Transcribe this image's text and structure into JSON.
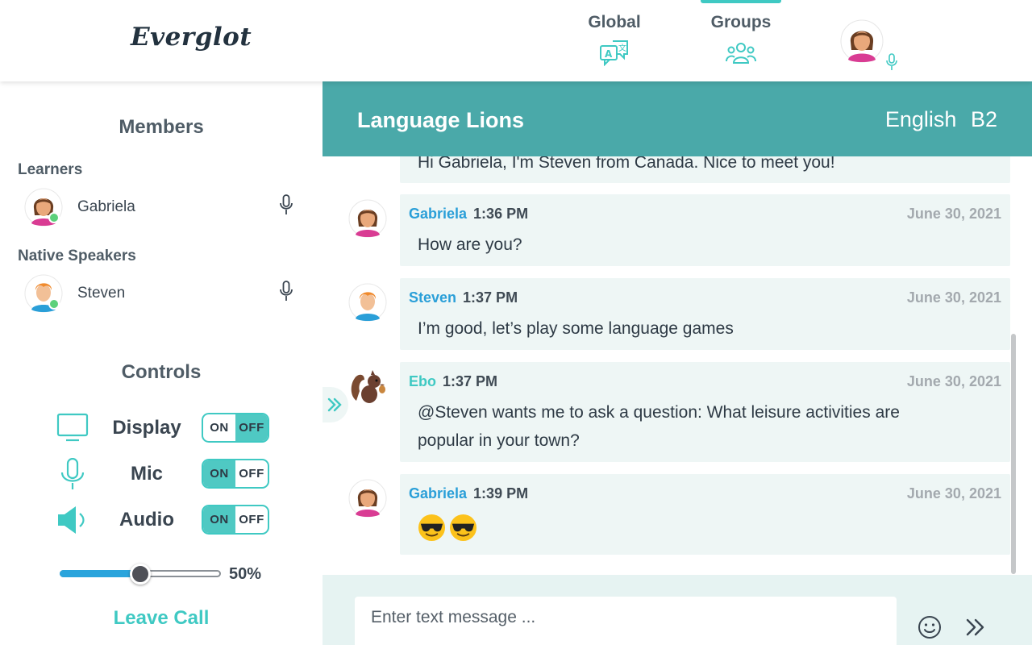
{
  "app": {
    "logo": "Everglot"
  },
  "nav": {
    "tabs": [
      {
        "label": "Global",
        "icon": "translate-icon",
        "active": false
      },
      {
        "label": "Groups",
        "icon": "group-icon",
        "active": true
      }
    ],
    "user_avatar": "user-avatar",
    "user_mic_icon": "mic-icon"
  },
  "sidebar": {
    "members_title": "Members",
    "learners_label": "Learners",
    "learners": [
      {
        "name": "Gabriela",
        "online": true
      }
    ],
    "native_label": "Native Speakers",
    "natives": [
      {
        "name": "Steven",
        "online": true
      }
    ],
    "controls_title": "Controls",
    "controls": [
      {
        "label": "Display",
        "icon": "monitor-icon",
        "on": "ON",
        "off": "OFF",
        "state": "OFF"
      },
      {
        "label": "Mic",
        "icon": "microphone-icon",
        "on": "ON",
        "off": "OFF",
        "state": "ON"
      },
      {
        "label": "Audio",
        "icon": "speaker-icon",
        "on": "ON",
        "off": "OFF",
        "state": "ON"
      }
    ],
    "volume": {
      "value": 0.5,
      "label": "50%"
    },
    "leave_label": "Leave Call"
  },
  "chat": {
    "group_name": "Language Lions",
    "language": "English",
    "level": "B2",
    "partial_message": "Hi Gabriela, I'm Steven from Canada. Nice to meet you!",
    "messages": [
      {
        "author": "Gabriela",
        "time": "1:36 PM",
        "date": "June 30, 2021",
        "text": "How are you?"
      },
      {
        "author": "Steven",
        "time": "1:37 PM",
        "date": "June 30, 2021",
        "text": "I’m good, let’s play some language games"
      },
      {
        "author": "Ebo",
        "time": "1:37 PM",
        "date": "June 30, 2021",
        "text": "@Steven wants me to ask a question: What leisure activities are popular in your town?"
      },
      {
        "author": "Gabriela",
        "time": "1:39 PM",
        "date": "June 30, 2021",
        "emojis": [
          "sunglasses-emoji",
          "sunglasses-emoji"
        ]
      }
    ],
    "composer": {
      "placeholder": "Enter text message ...",
      "value": ""
    }
  },
  "colors": {
    "accent": "#3fc9c3",
    "header": "#4aa9a9",
    "author": "#2a9fd8",
    "bubble": "#eef6f5"
  }
}
